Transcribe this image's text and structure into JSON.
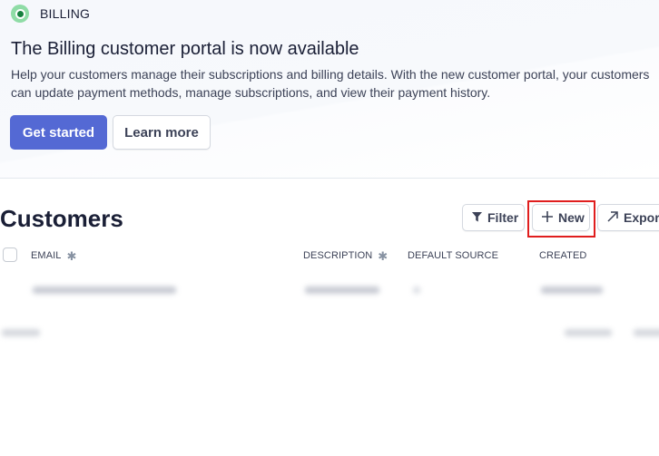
{
  "banner": {
    "badge_label": "BILLING",
    "title": "The Billing customer portal is now available",
    "description": "Help your customers manage their subscriptions and billing details. With the new customer portal, your customers can update payment methods, manage subscriptions, and view their payment history.",
    "primary_button": "Get started",
    "secondary_button": "Learn more",
    "accent_color": "#5469d4",
    "status_color": "#15803d"
  },
  "customers": {
    "title": "Customers",
    "toolbar": {
      "filter_label": "Filter",
      "new_label": "New",
      "export_label": "Export",
      "filter_icon": "funnel-icon",
      "new_icon": "plus-icon",
      "export_icon": "arrow-up-right-icon"
    },
    "table": {
      "columns": [
        "EMAIL",
        "DESCRIPTION",
        "DEFAULT SOURCE",
        "CREATED"
      ],
      "rows_note": "row content blurred / unreadable"
    }
  },
  "highlight_color": "#e01e1e"
}
